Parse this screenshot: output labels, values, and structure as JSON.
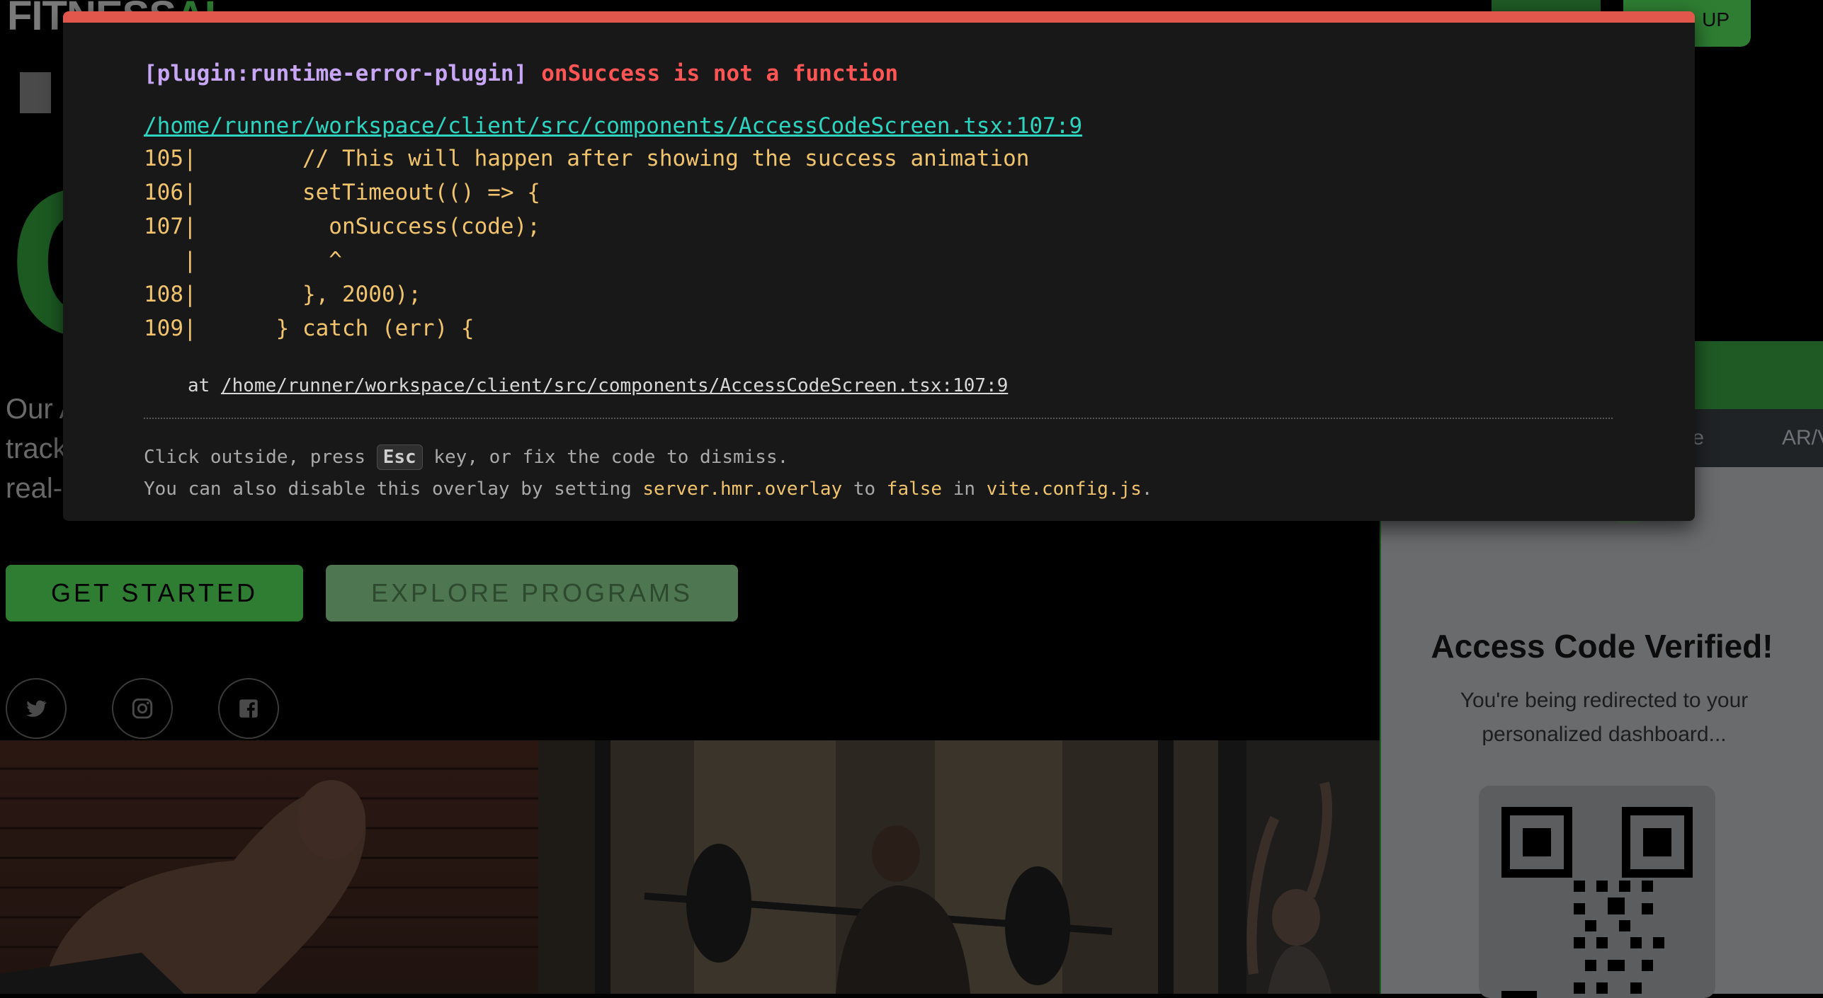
{
  "background_page": {
    "brand": {
      "text_main": "FITNESS",
      "text_ai": "AI"
    },
    "nav": {
      "signup_label": "UP"
    },
    "hero": {
      "headline_fragment": "C",
      "body_lines": [
        "Our A",
        "track",
        "real-"
      ],
      "get_started_label": "GET STARTED",
      "explore_label": "EXPLORE PROGRAMS"
    },
    "tabs": [
      "ode",
      "AR/V"
    ],
    "access_card": {
      "title": "Access Code Verified!",
      "subtitle": "You're being redirected to your personalized dashboard..."
    }
  },
  "error_overlay": {
    "plugin": "[plugin:runtime-error-plugin]",
    "message": "onSuccess is not a function",
    "file_link": "/home/runner/workspace/client/src/components/AccessCodeScreen.tsx:107:9",
    "code_lines": [
      "105|        // This will happen after showing the success animation",
      "106|        setTimeout(() => {",
      "107|          onSuccess(code);",
      "   |          ^",
      "108|        }, 2000);",
      "109|      } catch (err) {"
    ],
    "stack_prefix": "at ",
    "stack_link": "/home/runner/workspace/client/src/components/AccessCodeScreen.tsx:107:9",
    "tip_before_key": "Click outside, press ",
    "tip_key": "Esc",
    "tip_after_key": " key, or fix the code to dismiss.",
    "tip2_a": "You can also disable this overlay by setting ",
    "tip2_setting": "server.hmr.overlay",
    "tip2_b": " to ",
    "tip2_value": "false",
    "tip2_c": " in ",
    "tip2_file": "vite.config.js",
    "tip2_d": "."
  },
  "colors": {
    "overlay_bg": "#181818",
    "overlay_top_border": "#e2574c",
    "plugin": "#c7a6f5",
    "error_message": "#ff5555",
    "file_link": "#2dd4bf",
    "code": "#f0c36d",
    "brand_green": "#2e7d32"
  }
}
